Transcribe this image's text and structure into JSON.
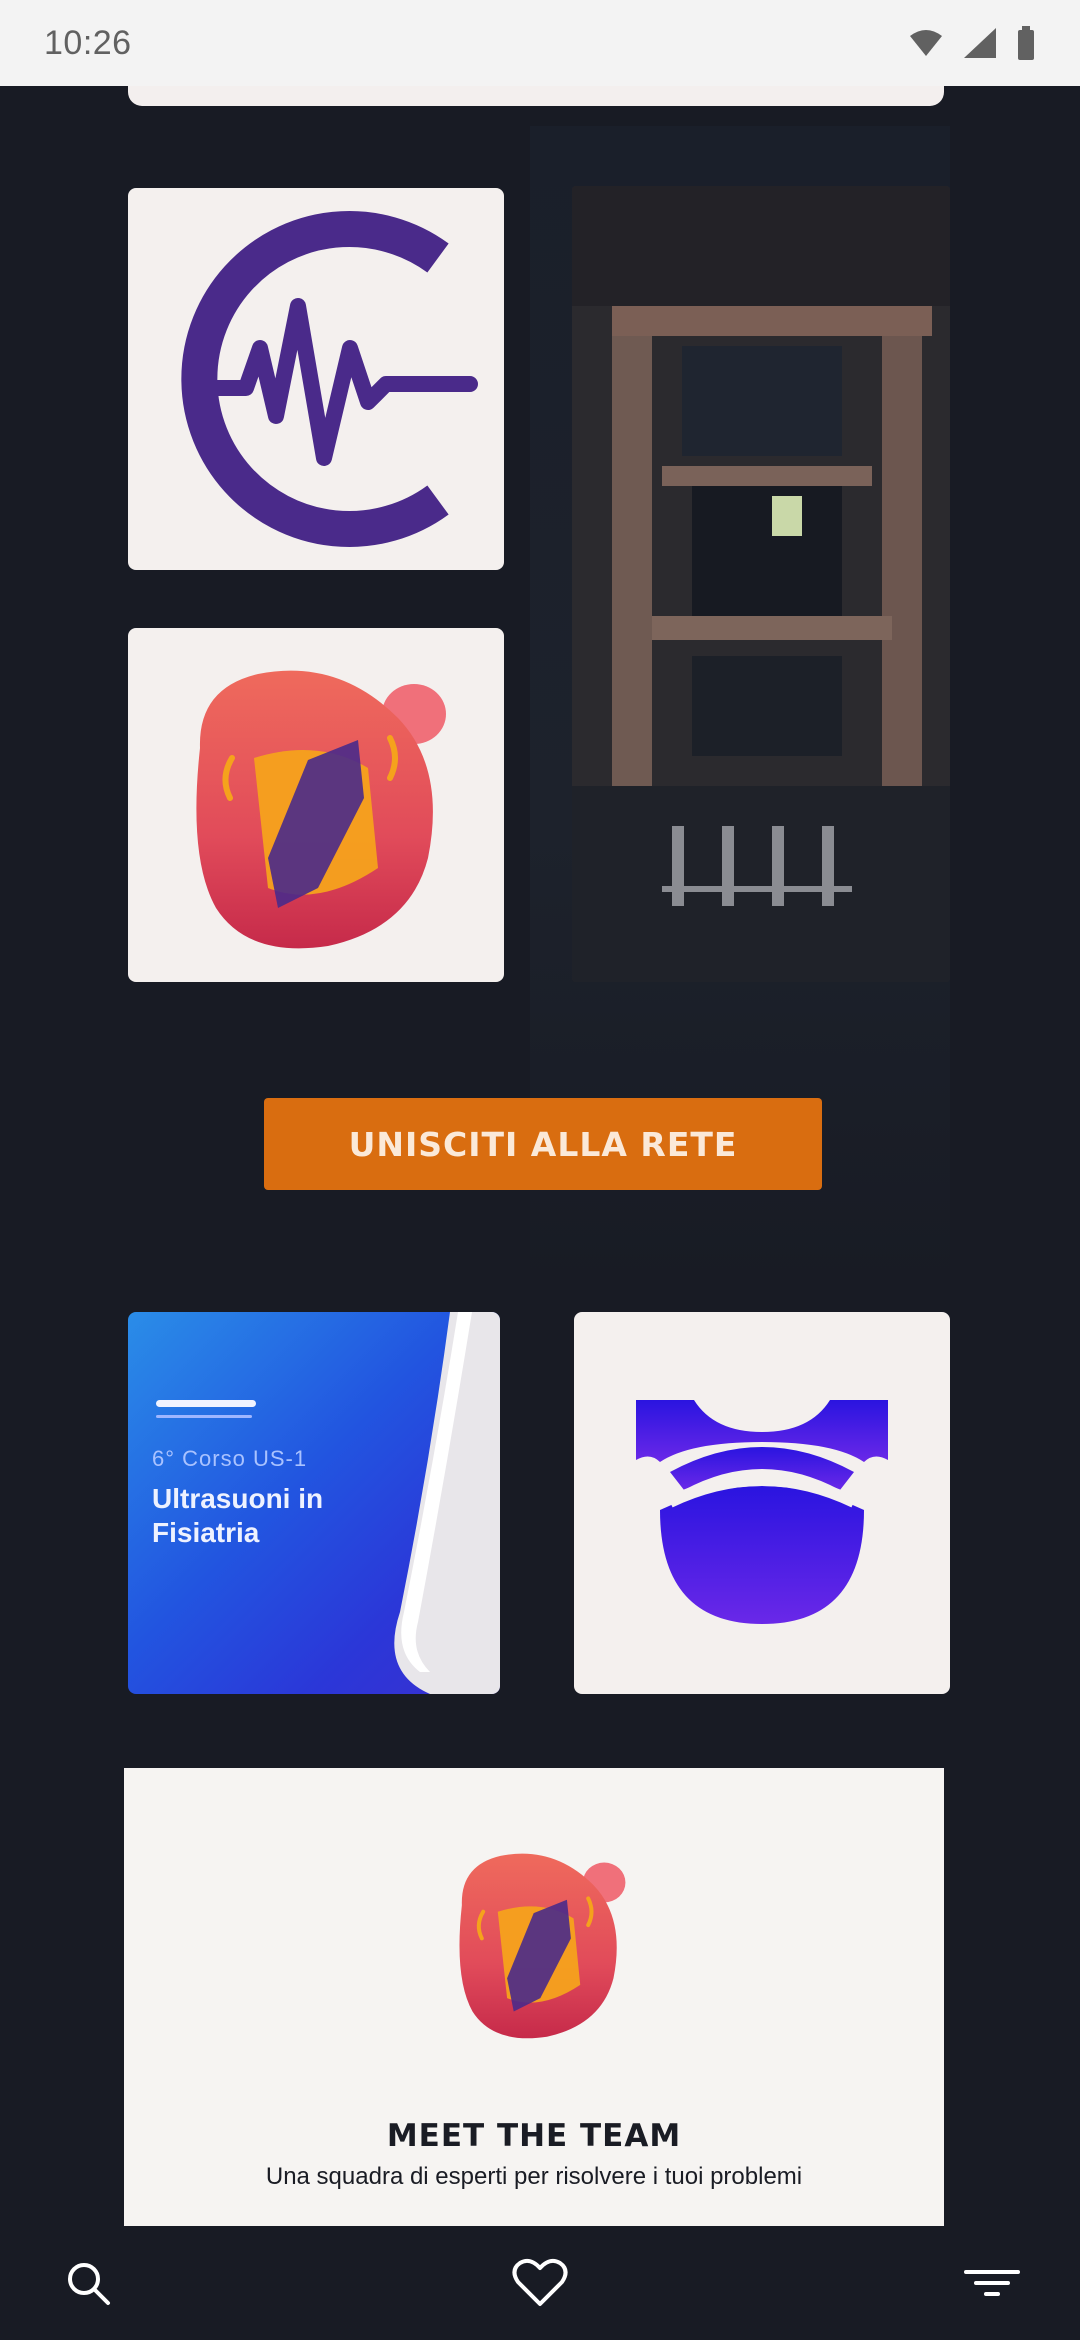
{
  "status_bar": {
    "time": "10:26",
    "icons": [
      "wifi-icon",
      "signal-icon",
      "battery-icon"
    ]
  },
  "cta": {
    "label": "UNISCITI ALLA RETE"
  },
  "course_tile": {
    "tag": "6° Corso US-1",
    "title": "Ultrasuoni in Fisiatria"
  },
  "team": {
    "heading": "MEET THE TEAM",
    "subtitle": "Una squadra di esperti per risolvere i tuoi problemi"
  },
  "bottom_nav": {
    "items": [
      "search-icon",
      "heart-icon",
      "menu-icon"
    ]
  },
  "colors": {
    "background": "#181b24",
    "accent_orange": "#d96d10",
    "logo_purple": "#4a2a8a",
    "tile_bg": "#f4f0ee"
  }
}
